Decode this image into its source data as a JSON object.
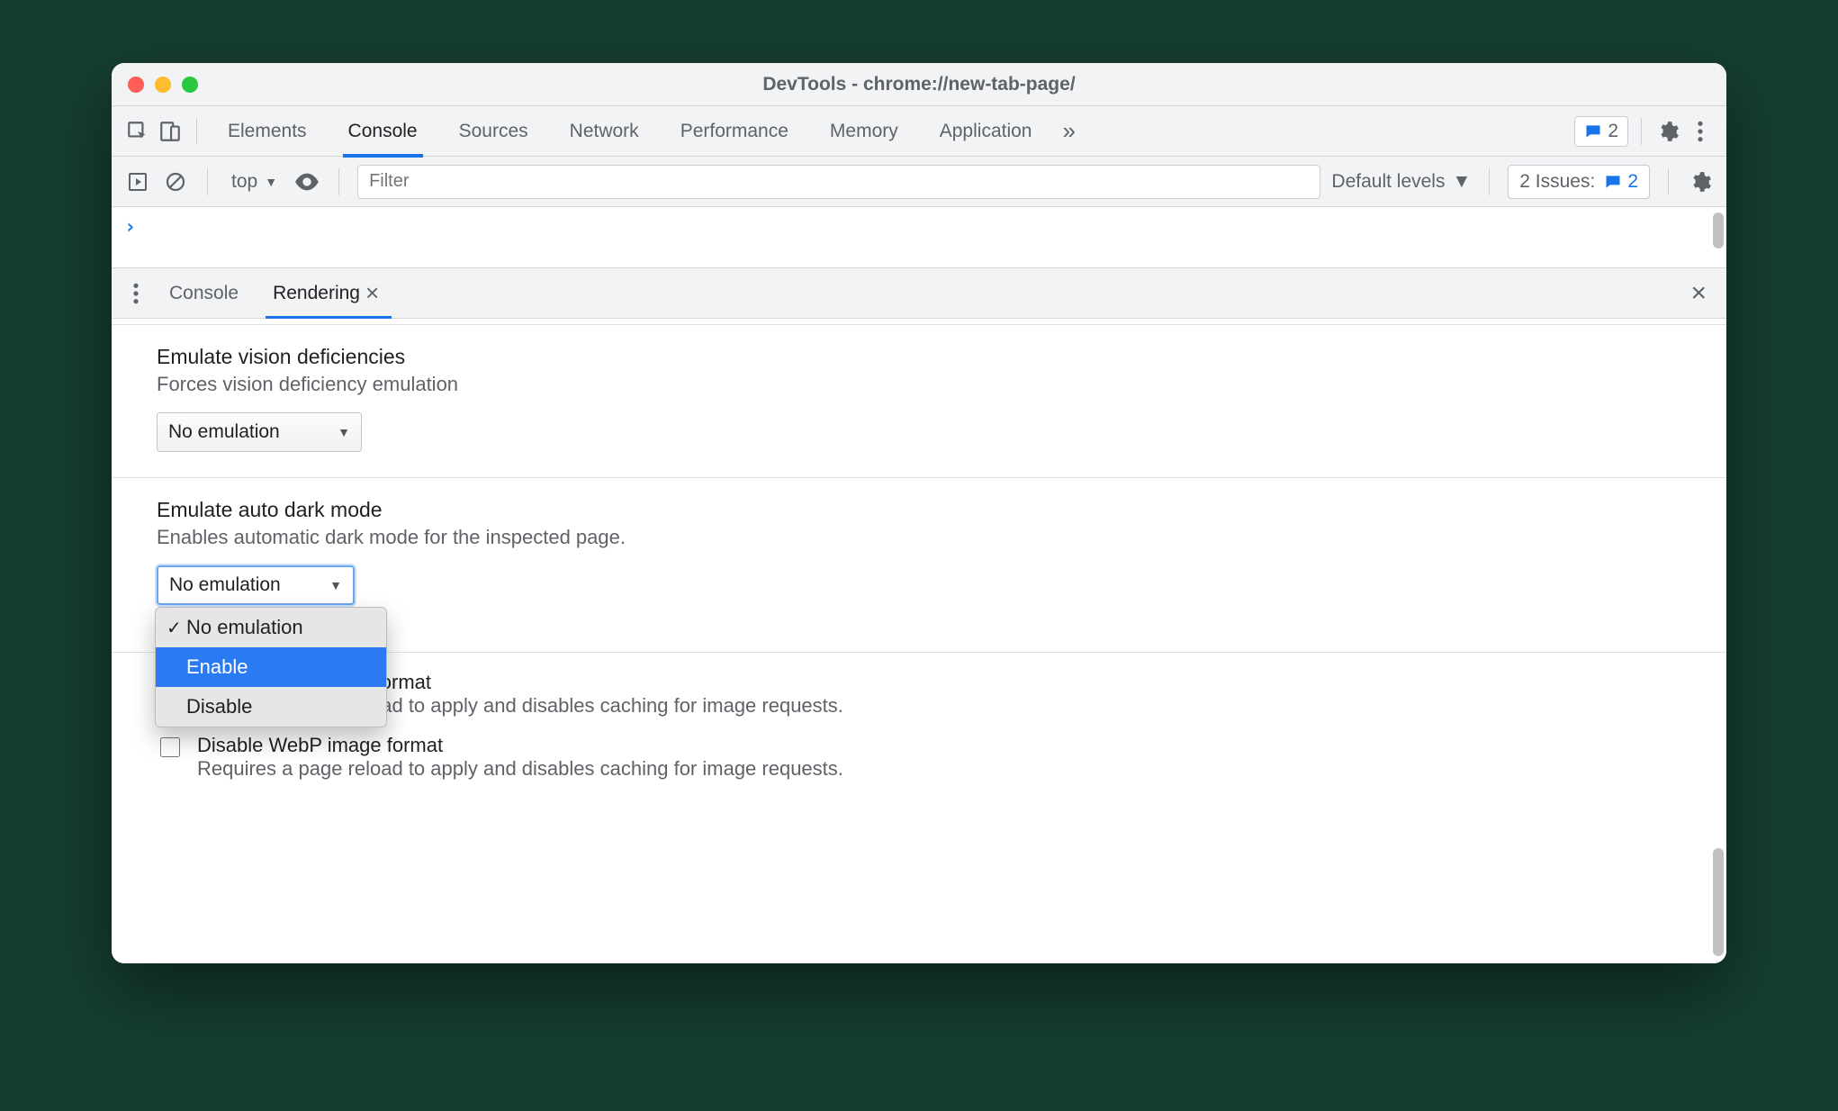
{
  "window": {
    "title": "DevTools - chrome://new-tab-page/"
  },
  "mainTabs": {
    "items": [
      "Elements",
      "Console",
      "Sources",
      "Network",
      "Performance",
      "Memory",
      "Application"
    ],
    "activeIndex": 1,
    "messagesBadge": "2"
  },
  "consoleBar": {
    "context": "top",
    "filterPlaceholder": "Filter",
    "levels": "Default levels",
    "issuesLabel": "2 Issues:",
    "issuesCount": "2"
  },
  "drawerTabs": {
    "items": [
      "Console",
      "Rendering"
    ],
    "activeIndex": 1
  },
  "rendering": {
    "vision": {
      "heading": "Emulate vision deficiencies",
      "desc": "Forces vision deficiency emulation",
      "selected": "No emulation"
    },
    "darkmode": {
      "heading": "Emulate auto dark mode",
      "desc": "Enables automatic dark mode for the inspected page.",
      "selected": "No emulation",
      "options": [
        "No emulation",
        "Enable",
        "Disable"
      ],
      "highlightIndex": 1
    },
    "avif": {
      "label": "Disable AVIF image format",
      "desc": "Requires a page reload to apply and disables caching for image requests."
    },
    "webp": {
      "label": "Disable WebP image format",
      "desc": "Requires a page reload to apply and disables caching for image requests."
    }
  }
}
